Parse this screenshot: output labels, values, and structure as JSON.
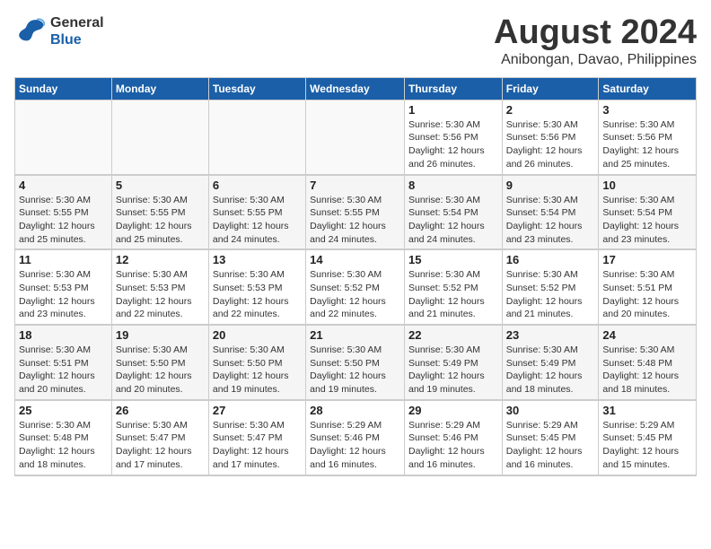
{
  "header": {
    "logo_line1": "General",
    "logo_line2": "Blue",
    "title": "August 2024",
    "subtitle": "Anibongan, Davao, Philippines"
  },
  "columns": [
    "Sunday",
    "Monday",
    "Tuesday",
    "Wednesday",
    "Thursday",
    "Friday",
    "Saturday"
  ],
  "weeks": [
    [
      {
        "day": "",
        "info": ""
      },
      {
        "day": "",
        "info": ""
      },
      {
        "day": "",
        "info": ""
      },
      {
        "day": "",
        "info": ""
      },
      {
        "day": "1",
        "info": "Sunrise: 5:30 AM\nSunset: 5:56 PM\nDaylight: 12 hours\nand 26 minutes."
      },
      {
        "day": "2",
        "info": "Sunrise: 5:30 AM\nSunset: 5:56 PM\nDaylight: 12 hours\nand 26 minutes."
      },
      {
        "day": "3",
        "info": "Sunrise: 5:30 AM\nSunset: 5:56 PM\nDaylight: 12 hours\nand 25 minutes."
      }
    ],
    [
      {
        "day": "4",
        "info": "Sunrise: 5:30 AM\nSunset: 5:55 PM\nDaylight: 12 hours\nand 25 minutes."
      },
      {
        "day": "5",
        "info": "Sunrise: 5:30 AM\nSunset: 5:55 PM\nDaylight: 12 hours\nand 25 minutes."
      },
      {
        "day": "6",
        "info": "Sunrise: 5:30 AM\nSunset: 5:55 PM\nDaylight: 12 hours\nand 24 minutes."
      },
      {
        "day": "7",
        "info": "Sunrise: 5:30 AM\nSunset: 5:55 PM\nDaylight: 12 hours\nand 24 minutes."
      },
      {
        "day": "8",
        "info": "Sunrise: 5:30 AM\nSunset: 5:54 PM\nDaylight: 12 hours\nand 24 minutes."
      },
      {
        "day": "9",
        "info": "Sunrise: 5:30 AM\nSunset: 5:54 PM\nDaylight: 12 hours\nand 23 minutes."
      },
      {
        "day": "10",
        "info": "Sunrise: 5:30 AM\nSunset: 5:54 PM\nDaylight: 12 hours\nand 23 minutes."
      }
    ],
    [
      {
        "day": "11",
        "info": "Sunrise: 5:30 AM\nSunset: 5:53 PM\nDaylight: 12 hours\nand 23 minutes."
      },
      {
        "day": "12",
        "info": "Sunrise: 5:30 AM\nSunset: 5:53 PM\nDaylight: 12 hours\nand 22 minutes."
      },
      {
        "day": "13",
        "info": "Sunrise: 5:30 AM\nSunset: 5:53 PM\nDaylight: 12 hours\nand 22 minutes."
      },
      {
        "day": "14",
        "info": "Sunrise: 5:30 AM\nSunset: 5:52 PM\nDaylight: 12 hours\nand 22 minutes."
      },
      {
        "day": "15",
        "info": "Sunrise: 5:30 AM\nSunset: 5:52 PM\nDaylight: 12 hours\nand 21 minutes."
      },
      {
        "day": "16",
        "info": "Sunrise: 5:30 AM\nSunset: 5:52 PM\nDaylight: 12 hours\nand 21 minutes."
      },
      {
        "day": "17",
        "info": "Sunrise: 5:30 AM\nSunset: 5:51 PM\nDaylight: 12 hours\nand 20 minutes."
      }
    ],
    [
      {
        "day": "18",
        "info": "Sunrise: 5:30 AM\nSunset: 5:51 PM\nDaylight: 12 hours\nand 20 minutes."
      },
      {
        "day": "19",
        "info": "Sunrise: 5:30 AM\nSunset: 5:50 PM\nDaylight: 12 hours\nand 20 minutes."
      },
      {
        "day": "20",
        "info": "Sunrise: 5:30 AM\nSunset: 5:50 PM\nDaylight: 12 hours\nand 19 minutes."
      },
      {
        "day": "21",
        "info": "Sunrise: 5:30 AM\nSunset: 5:50 PM\nDaylight: 12 hours\nand 19 minutes."
      },
      {
        "day": "22",
        "info": "Sunrise: 5:30 AM\nSunset: 5:49 PM\nDaylight: 12 hours\nand 19 minutes."
      },
      {
        "day": "23",
        "info": "Sunrise: 5:30 AM\nSunset: 5:49 PM\nDaylight: 12 hours\nand 18 minutes."
      },
      {
        "day": "24",
        "info": "Sunrise: 5:30 AM\nSunset: 5:48 PM\nDaylight: 12 hours\nand 18 minutes."
      }
    ],
    [
      {
        "day": "25",
        "info": "Sunrise: 5:30 AM\nSunset: 5:48 PM\nDaylight: 12 hours\nand 18 minutes."
      },
      {
        "day": "26",
        "info": "Sunrise: 5:30 AM\nSunset: 5:47 PM\nDaylight: 12 hours\nand 17 minutes."
      },
      {
        "day": "27",
        "info": "Sunrise: 5:30 AM\nSunset: 5:47 PM\nDaylight: 12 hours\nand 17 minutes."
      },
      {
        "day": "28",
        "info": "Sunrise: 5:29 AM\nSunset: 5:46 PM\nDaylight: 12 hours\nand 16 minutes."
      },
      {
        "day": "29",
        "info": "Sunrise: 5:29 AM\nSunset: 5:46 PM\nDaylight: 12 hours\nand 16 minutes."
      },
      {
        "day": "30",
        "info": "Sunrise: 5:29 AM\nSunset: 5:45 PM\nDaylight: 12 hours\nand 16 minutes."
      },
      {
        "day": "31",
        "info": "Sunrise: 5:29 AM\nSunset: 5:45 PM\nDaylight: 12 hours\nand 15 minutes."
      }
    ]
  ]
}
